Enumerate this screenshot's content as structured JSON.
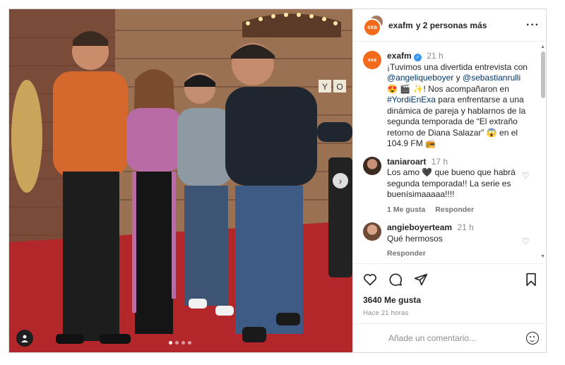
{
  "header": {
    "account": "exafm",
    "others": "y 2 personas más",
    "avatar_text": "exa",
    "more_icon": "ellipsis-icon"
  },
  "caption": {
    "username": "exafm",
    "time": "21 h",
    "text_1": "¡Tuvimos una divertida entrevista con",
    "mention_1": "@angeliqueboyer",
    "text_2": " y ",
    "mention_2": "@sebastianrulli",
    "text_3": " 😍 🎬 ✨! Nos acompañaron en ",
    "hashtag": "#YordiEnExa",
    "text_4": " para enfrentarse a una dinámica de pareja y hablarnos de la segunda temporada de “El extraño retorno de Diana Salazar” 😱 en el 104.9 FM 📻"
  },
  "comments": [
    {
      "username": "taniaroart",
      "time": "17 h",
      "text": "Los amo 🖤 que bueno que habrá segunda temporada!! La serie es buenísimaaaaa!!!!",
      "likes_label": "1 Me gusta",
      "reply_label": "Responder"
    },
    {
      "username": "angieboyerteam",
      "time": "21 h",
      "text": "Qué hermosos",
      "reply_label": "Responder"
    }
  ],
  "actions": {
    "likes": "3640 Me gusta",
    "posted": "Hace 21 horas",
    "comment_placeholder": "Añade un comentario..."
  },
  "carousel": {
    "slides": 4,
    "active_index": 0
  },
  "photo": {
    "sign_letters": [
      "Y",
      "O"
    ]
  },
  "colors": {
    "accent_exa": "#f26b1d",
    "verified": "#3897f0",
    "link": "#00376b"
  }
}
